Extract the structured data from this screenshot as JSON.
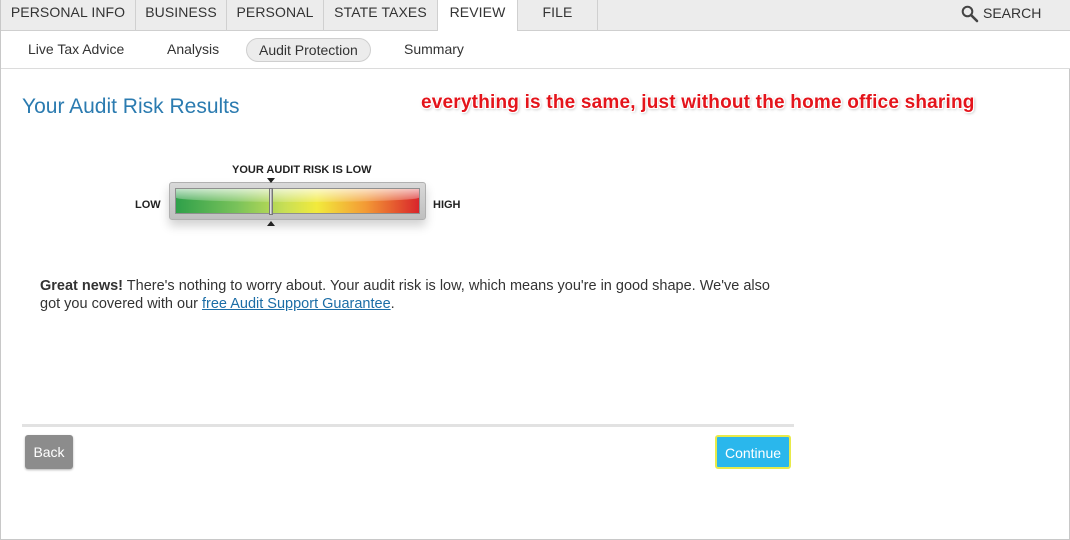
{
  "top_tabs": [
    {
      "label": "PERSONAL INFO"
    },
    {
      "label": "BUSINESS"
    },
    {
      "label": "PERSONAL"
    },
    {
      "label": "STATE TAXES"
    },
    {
      "label": "REVIEW",
      "active": true
    },
    {
      "label": "FILE"
    }
  ],
  "search": {
    "label": "SEARCH",
    "icon": "magnifier-icon"
  },
  "subnav": [
    {
      "label": "Live Tax Advice"
    },
    {
      "label": "Analysis"
    },
    {
      "label": "Audit Protection",
      "active": true
    },
    {
      "label": "Summary"
    }
  ],
  "page": {
    "title": "Your Audit Risk Results",
    "annotation": "everything is the same, just without the home office sharing"
  },
  "meter": {
    "caption": "YOUR AUDIT RISK IS LOW",
    "low_label": "LOW",
    "high_label": "HIGH",
    "level_fraction": 0.39
  },
  "message": {
    "lead": "Great news!",
    "body": " There's nothing to worry about. Your audit risk is low, which means you're in good shape. We've also got you covered with our ",
    "link": "free Audit Support Guarantee",
    "tail": "."
  },
  "buttons": {
    "back": "Back",
    "continue": "Continue"
  },
  "colors": {
    "title": "#2b7bb0",
    "annotation": "#e4141b",
    "continue_bg": "#2ab7ec",
    "continue_border": "#e8ea4a",
    "back_bg": "#8c8c8c",
    "link": "#1b6da6"
  }
}
